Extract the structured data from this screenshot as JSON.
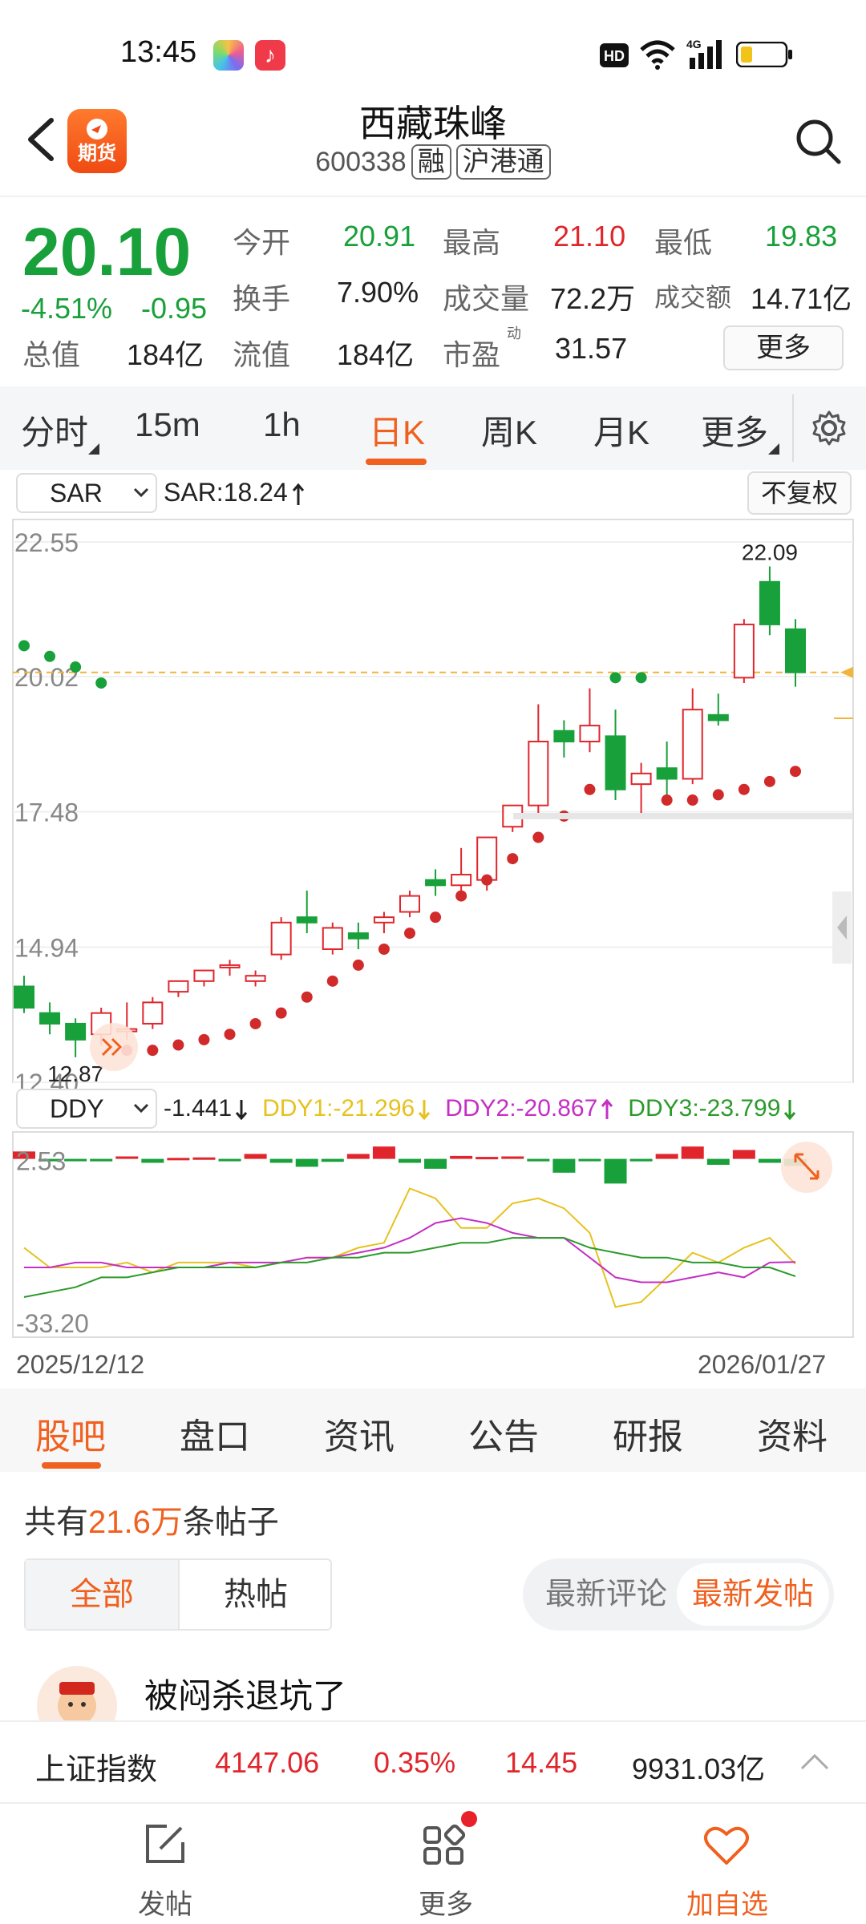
{
  "status_bar": {
    "time": "13:45",
    "network": "4G"
  },
  "header": {
    "badge_label": "期货",
    "stock_name": "西藏珠峰",
    "stock_code": "600338",
    "tags": [
      "融",
      "沪港通"
    ]
  },
  "quote": {
    "price": "20.10",
    "change_pct": "-4.51%",
    "change": "-0.95",
    "open_label": "今开",
    "open": "20.91",
    "high_label": "最高",
    "high": "21.10",
    "low_label": "最低",
    "low": "19.83",
    "turnover_label": "换手",
    "turnover": "7.90%",
    "volume_label": "成交量",
    "volume": "72.2万",
    "amount_label": "成交额",
    "amount": "14.71亿",
    "mktcap_label": "总值",
    "mktcap": "184亿",
    "float_label": "流值",
    "float_cap": "184亿",
    "pe_label": "市盈",
    "pe_sup": "动",
    "pe": "31.57",
    "more_label": "更多"
  },
  "ktabs": [
    "分时",
    "15m",
    "1h",
    "日K",
    "周K",
    "月K",
    "更多"
  ],
  "indicator": {
    "main_select": "SAR",
    "main_value": "SAR:18.24",
    "adjust_label": "不复权",
    "sub_select": "DDY",
    "ddy_value": "-1.441",
    "ddy1": "DDY1:-21.296",
    "ddy2": "DDY2:-20.867",
    "ddy3": "DDY3:-23.799",
    "sub_top_label": "2.53",
    "sub_bottom_label": "-33.20",
    "date_start": "2025/12/12",
    "date_end": "2026/01/27"
  },
  "chart_data": {
    "type": "candlestick",
    "y_ticks": [
      "22.55",
      "20.02",
      "17.48",
      "14.94",
      "12.40"
    ],
    "ylim": [
      12.4,
      22.55
    ],
    "last_price_line": 20.1,
    "max_label": "22.09",
    "min_label": "12.87",
    "candles": [
      {
        "o": 14.2,
        "h": 14.4,
        "c": 13.8,
        "l": 13.7
      },
      {
        "o": 13.7,
        "h": 13.9,
        "c": 13.5,
        "l": 13.3
      },
      {
        "o": 13.5,
        "h": 13.6,
        "c": 13.2,
        "l": 12.87
      },
      {
        "o": 13.3,
        "h": 13.8,
        "c": 13.7,
        "l": 13.1
      },
      {
        "o": 13.4,
        "h": 13.9,
        "c": 13.4,
        "l": 13.2
      },
      {
        "o": 13.5,
        "h": 14.0,
        "c": 13.9,
        "l": 13.4
      },
      {
        "o": 14.1,
        "h": 14.3,
        "c": 14.3,
        "l": 14.0
      },
      {
        "o": 14.3,
        "h": 14.5,
        "c": 14.5,
        "l": 14.2
      },
      {
        "o": 14.6,
        "h": 14.7,
        "c": 14.6,
        "l": 14.4
      },
      {
        "o": 14.3,
        "h": 14.5,
        "c": 14.4,
        "l": 14.2
      },
      {
        "o": 14.8,
        "h": 15.5,
        "c": 15.4,
        "l": 14.7
      },
      {
        "o": 15.5,
        "h": 16.0,
        "c": 15.4,
        "l": 15.2
      },
      {
        "o": 14.9,
        "h": 15.4,
        "c": 15.3,
        "l": 14.8
      },
      {
        "o": 15.2,
        "h": 15.4,
        "c": 15.1,
        "l": 14.9
      },
      {
        "o": 15.4,
        "h": 15.6,
        "c": 15.5,
        "l": 15.2
      },
      {
        "o": 15.6,
        "h": 16.0,
        "c": 15.9,
        "l": 15.5
      },
      {
        "o": 16.2,
        "h": 16.4,
        "c": 16.1,
        "l": 15.9
      },
      {
        "o": 16.1,
        "h": 16.8,
        "c": 16.3,
        "l": 15.9
      },
      {
        "o": 16.2,
        "h": 17.0,
        "c": 17.0,
        "l": 16.0
      },
      {
        "o": 17.2,
        "h": 17.4,
        "c": 17.6,
        "l": 17.1
      },
      {
        "o": 17.6,
        "h": 19.5,
        "c": 18.8,
        "l": 17.4
      },
      {
        "o": 19.0,
        "h": 19.2,
        "c": 18.8,
        "l": 18.5
      },
      {
        "o": 18.8,
        "h": 19.8,
        "c": 19.1,
        "l": 18.6
      },
      {
        "o": 18.9,
        "h": 19.4,
        "c": 17.9,
        "l": 17.7
      },
      {
        "o": 18.0,
        "h": 18.4,
        "c": 18.2,
        "l": 17.4
      },
      {
        "o": 18.3,
        "h": 18.8,
        "c": 18.1,
        "l": 17.6
      },
      {
        "o": 18.1,
        "h": 19.8,
        "c": 19.4,
        "l": 18.0
      },
      {
        "o": 19.3,
        "h": 19.7,
        "c": 19.2,
        "l": 19.1
      },
      {
        "o": 20.0,
        "h": 21.1,
        "c": 21.0,
        "l": 19.9
      },
      {
        "o": 21.8,
        "h": 22.09,
        "c": 21.0,
        "l": 20.8
      },
      {
        "o": 20.91,
        "h": 21.1,
        "c": 20.1,
        "l": 19.83
      }
    ],
    "sar": [
      20.6,
      20.4,
      20.2,
      19.9,
      13.0,
      13.0,
      13.1,
      13.2,
      13.3,
      13.5,
      13.7,
      14.0,
      14.3,
      14.6,
      14.9,
      15.2,
      15.5,
      15.9,
      16.2,
      16.6,
      17.0,
      17.4,
      17.9,
      20.0,
      20.0,
      17.7,
      17.7,
      17.8,
      17.9,
      18.05,
      18.24
    ],
    "ddy_bars": [
      1.5,
      -0.5,
      -0.3,
      -0.5,
      0.5,
      -0.8,
      0.2,
      0.3,
      -0.4,
      1.0,
      -0.8,
      -1.6,
      -0.6,
      1.0,
      2.5,
      -0.8,
      -2.0,
      0.6,
      0.4,
      0.5,
      -0.5,
      -2.8,
      -0.4,
      -5.0,
      -0.5,
      1.0,
      2.5,
      -1.2,
      1.8,
      -0.8,
      -1.441
    ],
    "ddy_ylim": [
      -33.2,
      2.53
    ],
    "ddy1_line": [
      -18,
      -22,
      -22,
      -22,
      -21,
      -23,
      -21,
      -21,
      -21,
      -22,
      -21,
      -20,
      -20,
      -18,
      -17,
      -6,
      -8,
      -14,
      -14,
      -9,
      -8,
      -10,
      -15,
      -30,
      -29,
      -24,
      -19,
      -21,
      -18,
      -16,
      -21.3
    ],
    "ddy2_line": [
      -22,
      -22,
      -21,
      -21,
      -22,
      -22,
      -22,
      -22,
      -21,
      -21,
      -21,
      -20,
      -20,
      -19,
      -18,
      -16,
      -13,
      -12,
      -13,
      -15,
      -16,
      -16,
      -20,
      -24,
      -25,
      -25,
      -24,
      -23,
      -24,
      -21,
      -20.9
    ],
    "ddy3_line": [
      -28,
      -27,
      -26,
      -24,
      -24,
      -23,
      -22,
      -22,
      -22,
      -22,
      -21,
      -21,
      -20,
      -20,
      -19,
      -19,
      -18,
      -17,
      -17,
      -16,
      -16,
      -16,
      -18,
      -19,
      -20,
      -20,
      -21,
      -21,
      -22,
      -22,
      -23.8
    ]
  },
  "sub_tabs": [
    "股吧",
    "盘口",
    "资讯",
    "公告",
    "研报",
    "资料"
  ],
  "posts": {
    "count_prefix": "共有",
    "count": "21.6万",
    "count_suffix": "条帖子",
    "filter_all": "全部",
    "filter_hot": "热帖",
    "sort_comment": "最新评论",
    "sort_post": "最新发帖",
    "first_title": "被闷杀退坑了"
  },
  "index_bar": {
    "name": "上证指数",
    "value": "4147.06",
    "pct": "0.35%",
    "change": "14.45",
    "amount": "9931.03亿"
  },
  "bottom_nav": {
    "post": "发帖",
    "more": "更多",
    "watch": "加自选"
  },
  "colors": {
    "up": "#e0262c",
    "down": "#18a03a",
    "accent": "#f0601e",
    "ddy1": "#e6c21e",
    "ddy2": "#c42fc4",
    "ddy3": "#2b9a2b"
  }
}
